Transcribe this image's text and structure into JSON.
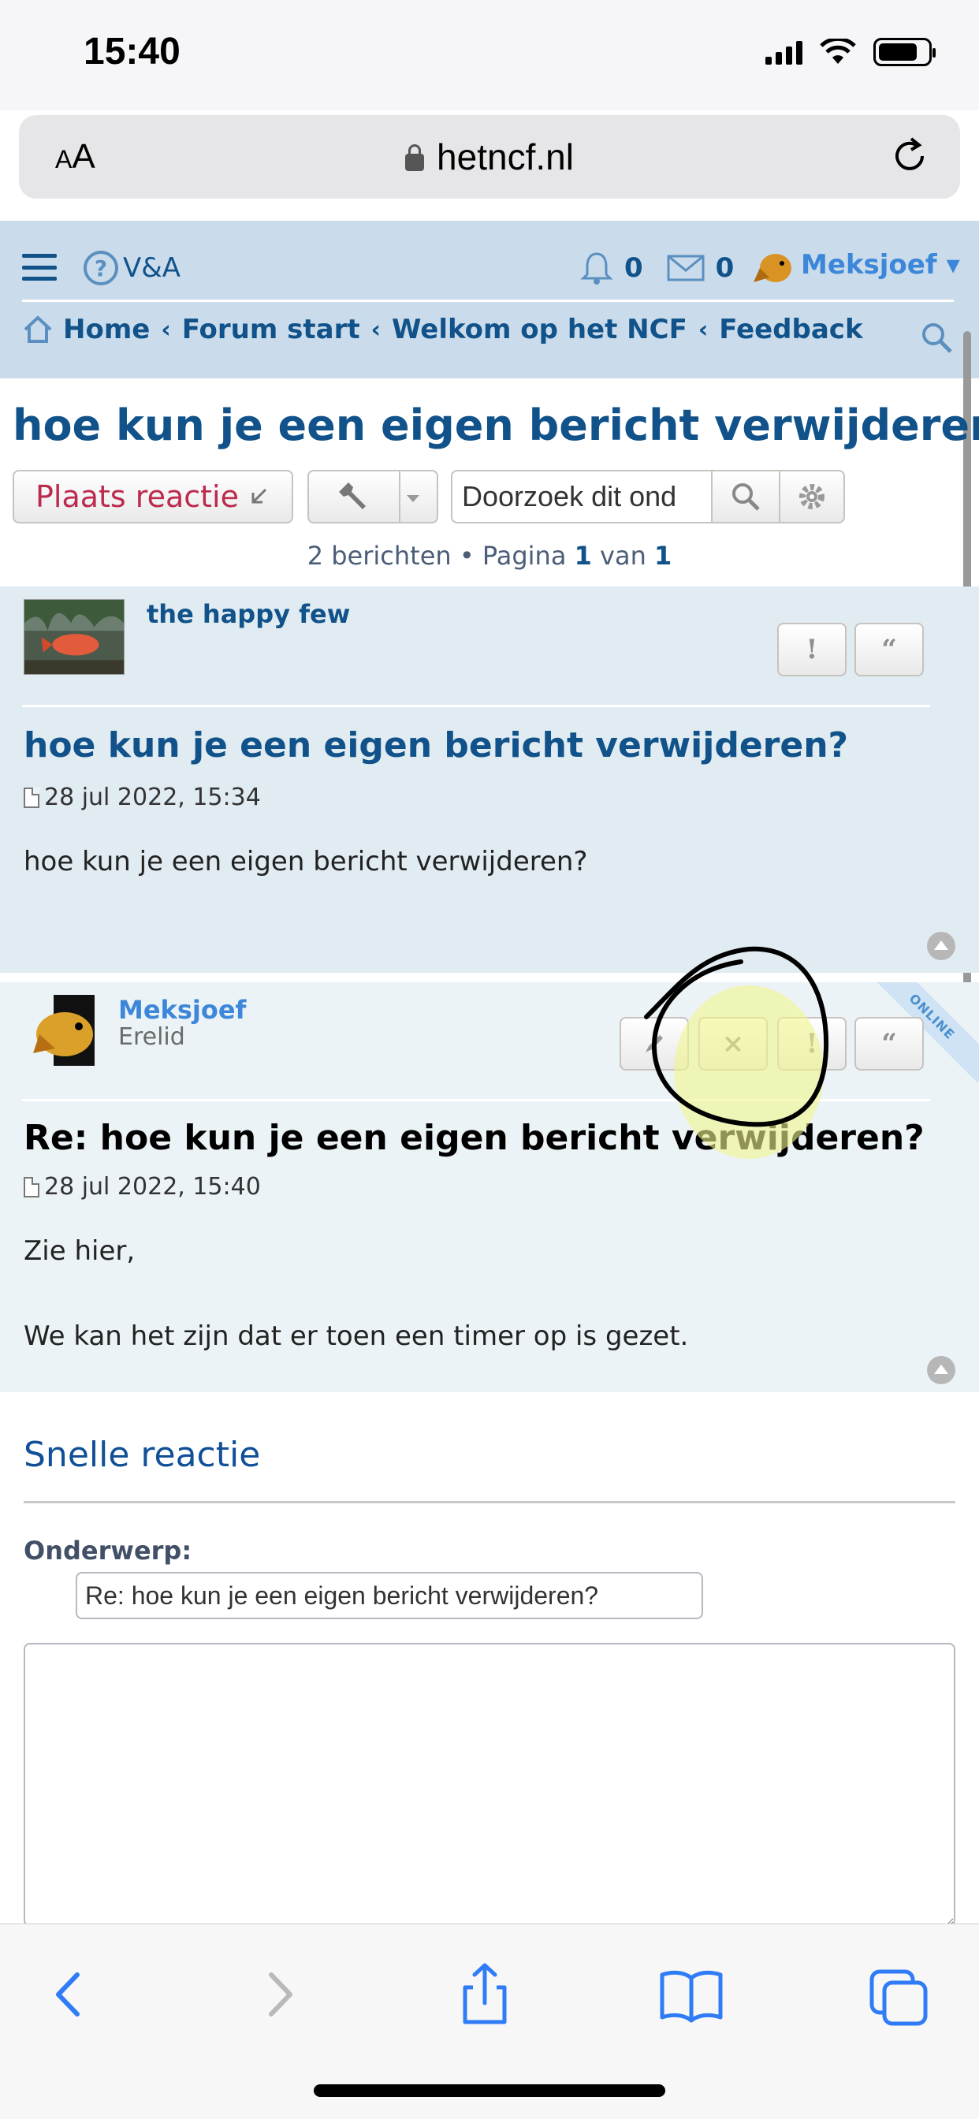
{
  "status": {
    "time": "15:40"
  },
  "browser": {
    "aa_small": "A",
    "aa_large": "A",
    "url": "hetncf.nl"
  },
  "nav": {
    "va_label": "V&A",
    "notifications_count": "0",
    "messages_count": "0",
    "username": "Meksjoef",
    "user_caret": "▾"
  },
  "breadcrumbs": [
    "Home",
    "Forum start",
    "Welkom op het NCF",
    "Feedback"
  ],
  "topic": {
    "title": "hoe kun je een eigen bericht verwijderen?",
    "reply_button": "Plaats reactie",
    "search_placeholder": "Doorzoek dit onderwerp…",
    "search_value": "Doorzoek dit ond",
    "pagination": {
      "count_text": "2 berichten • Pagina",
      "page": "1",
      "of_text": "van",
      "total": "1"
    }
  },
  "posts": [
    {
      "author": "the happy few",
      "title": "hoe kun je een eigen bericht verwijderen?",
      "date": "28 jul 2022, 15:34",
      "body": [
        "hoe kun je een eigen bericht verwijderen?"
      ],
      "buttons": {
        "report": "!",
        "quote": "“"
      }
    },
    {
      "author": "Meksjoef",
      "rank": "Erelid",
      "online_label": "ONLINE",
      "title": "Re: hoe kun je een eigen bericht verwijderen?",
      "date": "28 jul 2022, 15:40",
      "body": [
        "Zie hier,",
        "",
        "We kan het zijn dat er toen een timer op is gezet."
      ],
      "buttons": {
        "delete": "×",
        "report": "!",
        "quote": "“"
      }
    }
  ],
  "quick_reply": {
    "title": "Snelle reactie",
    "subject_label": "Onderwerp:",
    "subject_value": "Re: hoe kun je een eigen bericht verwijderen?",
    "message_value": ""
  },
  "colors": {
    "header_bg": "#cadceb",
    "link": "#105289",
    "username": "#3c87d9",
    "reply_button_text": "#bc2a4d",
    "post1_bg": "#e1ebf2",
    "post2_bg": "#ecf3f7",
    "highlight": "#f2f58c"
  },
  "icons": {
    "back": "chevron-left-icon",
    "forward": "chevron-right-icon",
    "share": "share-icon",
    "bookmarks": "book-icon",
    "tabs": "tabs-icon"
  }
}
